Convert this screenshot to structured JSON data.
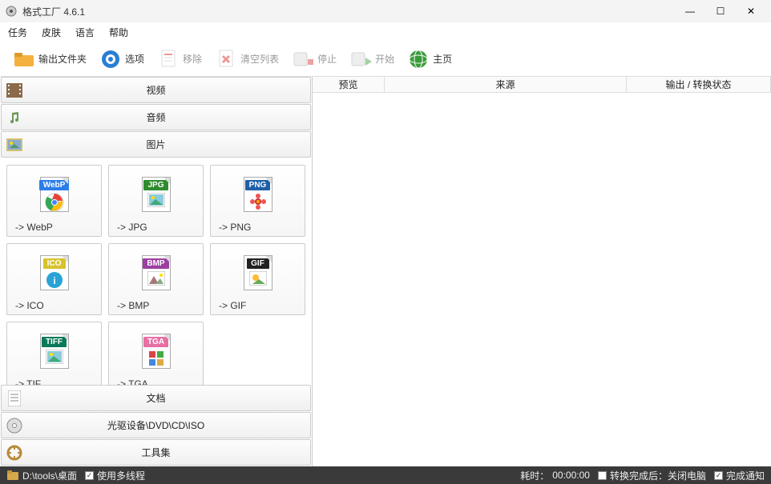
{
  "window": {
    "title": "格式工厂 4.6.1"
  },
  "menu": {
    "tasks": "任务",
    "skin": "皮肤",
    "language": "语言",
    "help": "帮助"
  },
  "toolbar": {
    "output_folder": "输出文件夹",
    "options": "选项",
    "remove": "移除",
    "clear_list": "清空列表",
    "stop": "停止",
    "start": "开始",
    "home": "主页"
  },
  "categories": {
    "video": "视频",
    "audio": "音频",
    "picture": "图片",
    "document": "文档",
    "optical": "光驱设备\\DVD\\CD\\ISO",
    "toolkit": "工具集"
  },
  "formats": [
    {
      "label": "-> WebP",
      "badge": "WebP",
      "badge_color": "#2b7de9",
      "inner": "chrome"
    },
    {
      "label": "-> JPG",
      "badge": "JPG",
      "badge_color": "#2e8b2e",
      "inner": "photo"
    },
    {
      "label": "-> PNG",
      "badge": "PNG",
      "badge_color": "#1e5fa8",
      "inner": "flower"
    },
    {
      "label": "-> ICO",
      "badge": "ICO",
      "badge_color": "#d8c22e",
      "inner": "info"
    },
    {
      "label": "-> BMP",
      "badge": "BMP",
      "badge_color": "#9b3fa0",
      "inner": "mountain"
    },
    {
      "label": "-> GIF",
      "badge": "GIF",
      "badge_color": "#222222",
      "inner": "sun"
    },
    {
      "label": "-> TIF",
      "badge": "TIFF",
      "badge_color": "#0a7a5a",
      "inner": "photo"
    },
    {
      "label": "-> TGA",
      "badge": "TGA",
      "badge_color": "#e66fa3",
      "inner": "blocks"
    }
  ],
  "columns": {
    "preview": "预览",
    "source": "来源",
    "status": "输出 / 转换状态"
  },
  "status": {
    "folder_path": "D:\\tools\\桌面",
    "multithread": "使用多线程",
    "elapsed_label": "耗时：",
    "elapsed_value": "00:00:00",
    "shutdown_after": "转换完成后：关闭电脑",
    "done_notify": "完成通知"
  },
  "icons": {
    "app": "app",
    "folder": "folder",
    "gear": "gear",
    "doc-x": "doc-x",
    "doc-clear": "doc-clear",
    "stop": "stop",
    "play": "play",
    "globe": "globe",
    "film": "film",
    "music": "music",
    "photo": "photo",
    "disc": "disc",
    "tools": "tools"
  }
}
